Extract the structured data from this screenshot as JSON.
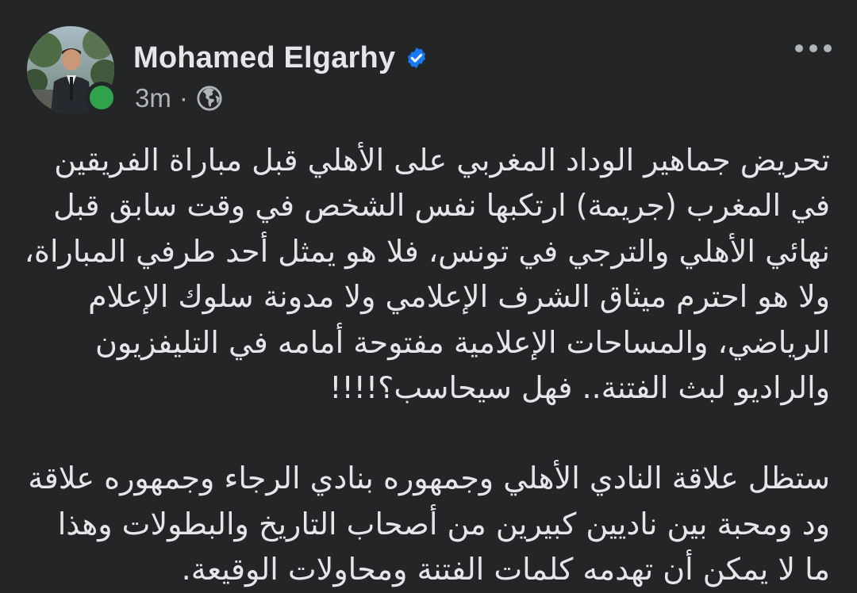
{
  "post": {
    "author": {
      "name": "Mohamed Elgarhy",
      "verified": true,
      "online": true,
      "avatar_icon": "avatar-photo"
    },
    "meta": {
      "time": "3m",
      "separator": "·",
      "audience_icon": "globe-icon"
    },
    "more_icon": "more-options-icon",
    "paragraphs": [
      {
        "lines": [
          "تحريض جماهير الوداد المغربي على الأهلي قبل مباراة الفريقين",
          "في المغرب (جريمة) ارتكبها نفس الشخص في وقت سابق قبل",
          "نهائي الأهلي والترجي في تونس، فلا هو يمثل أحد طرفي المباراة،",
          "ولا هو احترم ميثاق الشرف الإعلامي ولا مدونة سلوك الإعلام",
          "الرياضي، والمساحات الإعلامية مفتوحة أمامه في التليفزيون",
          "والراديو لبث الفتنة.. فهل سيحاسب؟!!!!"
        ]
      },
      {
        "lines": [
          "ستظل علاقة النادي الأهلي وجمهوره بنادي الرجاء وجمهوره علاقة",
          "ود ومحبة بين ناديين كبيرين من أصحاب التاريخ والبطولات وهذا",
          "ما لا يمكن أن تهدمه كلمات الفتنة ومحاولات الوقيعة."
        ]
      }
    ]
  },
  "colors": {
    "background": "#242526",
    "primary_text": "#e4e6eb",
    "secondary_text": "#b0b3b8",
    "verified_blue": "#1877f2",
    "online_green": "#31a24c"
  }
}
